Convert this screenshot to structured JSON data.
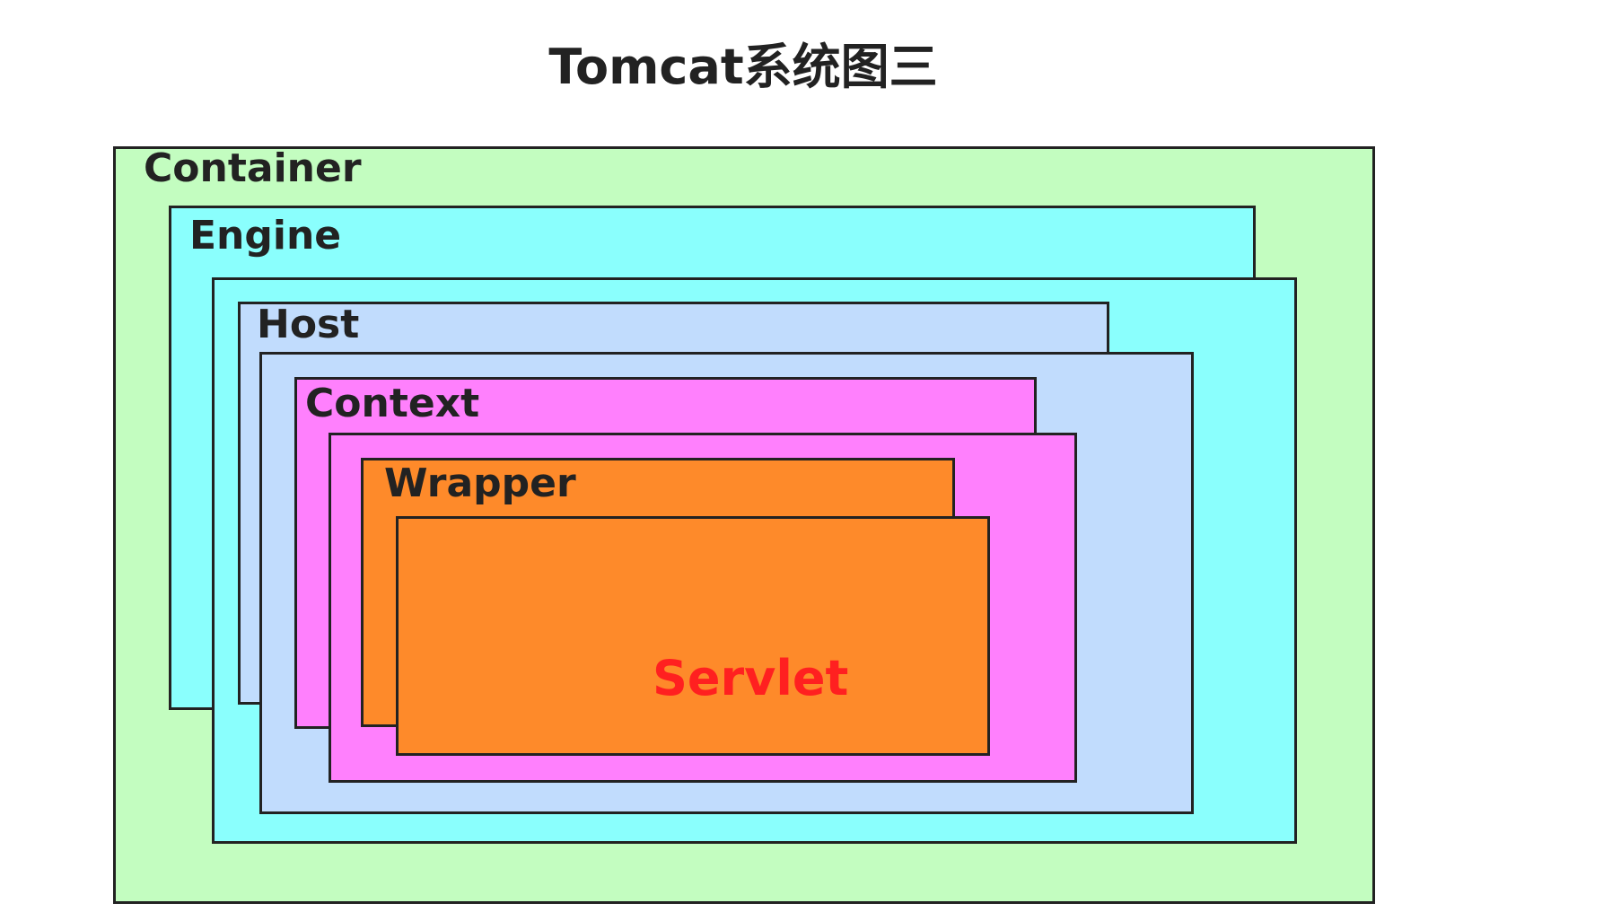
{
  "title": "Tomcat系统图三",
  "colors": {
    "container": "#c3fdc0",
    "engine": "#8afffd",
    "host": "#c1dcfd",
    "context": "#ff80fd",
    "wrapper": "#fe8a2a",
    "servlet_text": "#ff2020",
    "border": "#222222"
  },
  "layers": {
    "container": {
      "label": "Container"
    },
    "engine": {
      "label": "Engine"
    },
    "host": {
      "label": "Host"
    },
    "context": {
      "label": "Context"
    },
    "wrapper": {
      "label": "Wrapper"
    },
    "servlet": {
      "label": "Servlet"
    }
  }
}
